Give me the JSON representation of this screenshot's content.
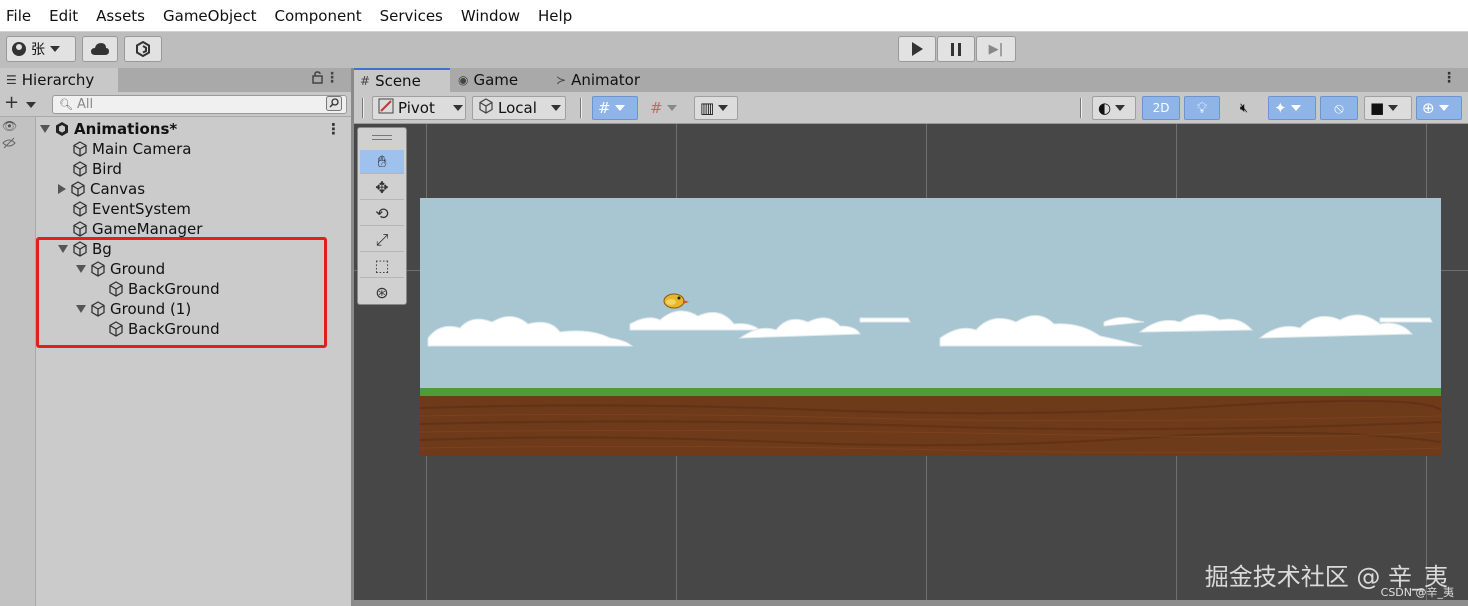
{
  "menu": [
    "File",
    "Edit",
    "Assets",
    "GameObject",
    "Component",
    "Services",
    "Window",
    "Help"
  ],
  "toolbar": {
    "account_label": "张",
    "cloud_icon": "cloud-icon",
    "collab_icon": "collab-icon",
    "play_icon": "play-icon",
    "pause_icon": "pause-icon",
    "step_icon": "step-icon"
  },
  "hierarchy": {
    "tab_label": "Hierarchy",
    "add_label": "+",
    "search_placeholder": "All",
    "scene_name": "Animations*",
    "items": [
      {
        "label": "Main Camera",
        "depth": 0,
        "fold": "none"
      },
      {
        "label": "Bird",
        "depth": 0,
        "fold": "none"
      },
      {
        "label": "Canvas",
        "depth": 0,
        "fold": "collapsed"
      },
      {
        "label": "EventSystem",
        "depth": 0,
        "fold": "none"
      },
      {
        "label": "GameManager",
        "depth": 0,
        "fold": "none"
      },
      {
        "label": "Bg",
        "depth": 0,
        "fold": "expanded"
      },
      {
        "label": "Ground",
        "depth": 1,
        "fold": "expanded"
      },
      {
        "label": "BackGround",
        "depth": 2,
        "fold": "none"
      },
      {
        "label": "Ground (1)",
        "depth": 1,
        "fold": "expanded"
      },
      {
        "label": "BackGround",
        "depth": 2,
        "fold": "none"
      }
    ],
    "highlight_color": "#e0201c"
  },
  "scene_panel": {
    "tabs": [
      "Scene",
      "Game",
      "Animator"
    ],
    "active_tab": "Scene",
    "pivot_label": "Pivot",
    "local_label": "Local",
    "mode_2d_label": "2D",
    "accent_color": "#3a72d8"
  },
  "watermark": {
    "main": "掘金技术社区 @ 辛_夷",
    "sub": "CSDN @辛_夷"
  }
}
